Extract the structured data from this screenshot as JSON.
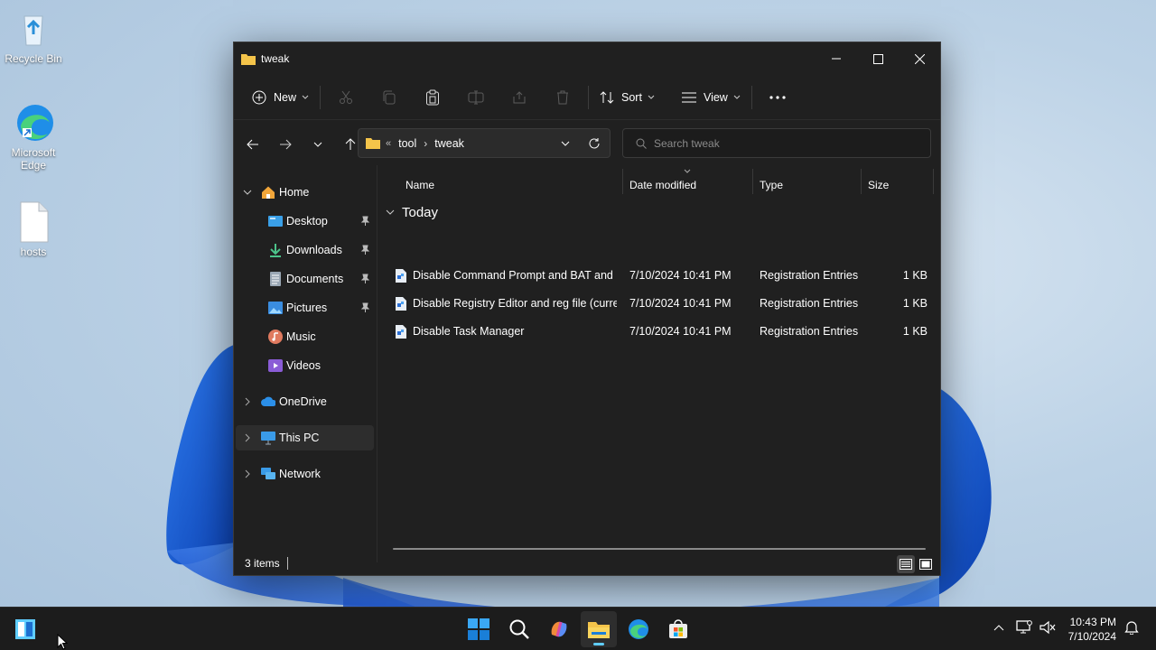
{
  "colors": {
    "window_bg": "#202020",
    "accent": "#60cdff",
    "folder": "#f4c44a",
    "taskbar": "#1c1c1c"
  },
  "desktop": {
    "icons": [
      {
        "label": "Recycle Bin",
        "icon": "recycle-bin-icon"
      },
      {
        "label": "Microsoft Edge",
        "icon": "edge-icon"
      },
      {
        "label": "hosts",
        "icon": "file-icon"
      }
    ]
  },
  "window": {
    "title": "tweak",
    "commands": {
      "new": "New",
      "sort": "Sort",
      "view": "View"
    },
    "address": {
      "crumbs": [
        "tool",
        "tweak"
      ]
    },
    "search": {
      "placeholder": "Search tweak"
    },
    "sidebar": [
      {
        "label": "Home",
        "icon": "home-icon",
        "expanded": true
      },
      {
        "label": "Desktop",
        "icon": "desktop-icon",
        "pinned": true
      },
      {
        "label": "Downloads",
        "icon": "download-icon",
        "pinned": true
      },
      {
        "label": "Documents",
        "icon": "documents-icon",
        "pinned": true
      },
      {
        "label": "Pictures",
        "icon": "pictures-icon",
        "pinned": true
      },
      {
        "label": "Music",
        "icon": "music-icon"
      },
      {
        "label": "Videos",
        "icon": "videos-icon"
      },
      {
        "label": "OneDrive",
        "icon": "onedrive-icon"
      },
      {
        "label": "This PC",
        "icon": "this-pc-icon",
        "selected": true
      },
      {
        "label": "Network",
        "icon": "network-icon"
      }
    ],
    "columns": {
      "name": "Name",
      "date": "Date modified",
      "type": "Type",
      "size": "Size"
    },
    "group": "Today",
    "files": [
      {
        "name": "Disable Command Prompt and BAT and ...",
        "date": "7/10/2024 10:41 PM",
        "type": "Registration Entries",
        "size": "1 KB"
      },
      {
        "name": "Disable Registry Editor and reg file (curre...",
        "date": "7/10/2024 10:41 PM",
        "type": "Registration Entries",
        "size": "1 KB"
      },
      {
        "name": "Disable Task Manager",
        "date": "7/10/2024 10:41 PM",
        "type": "Registration Entries",
        "size": "1 KB"
      }
    ],
    "status": {
      "items": "3 items"
    }
  },
  "taskbar": {
    "apps": [
      "start-icon",
      "search-icon",
      "copilot-icon",
      "file-explorer-icon",
      "edge-icon",
      "store-icon"
    ],
    "time": "10:43 PM",
    "date": "7/10/2024"
  }
}
